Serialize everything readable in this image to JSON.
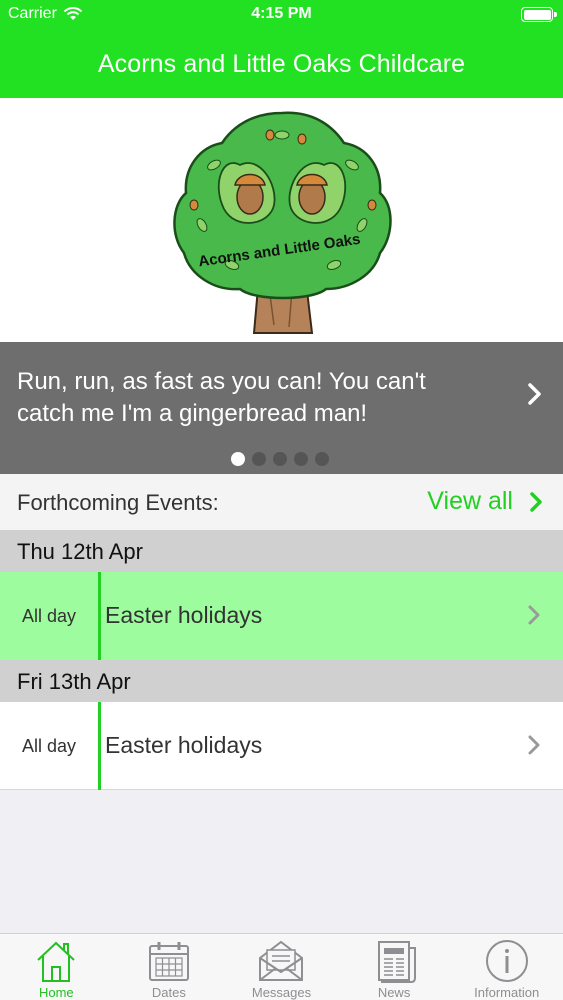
{
  "status": {
    "carrier": "Carrier",
    "time": "4:15 PM"
  },
  "header": {
    "title": "Acorns and Little Oaks Childcare"
  },
  "logo": {
    "text": "Acorns and Little Oaks"
  },
  "banner": {
    "text": "Run, run, as fast as you can! You can't catch me I'm a gingerbread man!",
    "page_count": 5,
    "active_page": 1
  },
  "events": {
    "label": "Forthcoming Events:",
    "view_all": "View all",
    "groups": [
      {
        "date": "Thu 12th Apr",
        "items": [
          {
            "time": "All day",
            "title": "Easter holidays",
            "highlighted": true
          }
        ]
      },
      {
        "date": "Fri 13th Apr",
        "items": [
          {
            "time": "All day",
            "title": "Easter holidays",
            "highlighted": false
          }
        ]
      }
    ]
  },
  "tabs": [
    {
      "label": "Home",
      "icon": "home-icon",
      "active": true
    },
    {
      "label": "Dates",
      "icon": "calendar-icon",
      "active": false
    },
    {
      "label": "Messages",
      "icon": "envelope-icon",
      "active": false
    },
    {
      "label": "News",
      "icon": "newspaper-icon",
      "active": false
    },
    {
      "label": "Information",
      "icon": "info-icon",
      "active": false
    }
  ],
  "colors": {
    "brand": "#22e022",
    "accent": "#22d022",
    "highlight_row": "#9dfc9d",
    "banner_bg": "#6e6e6e"
  }
}
